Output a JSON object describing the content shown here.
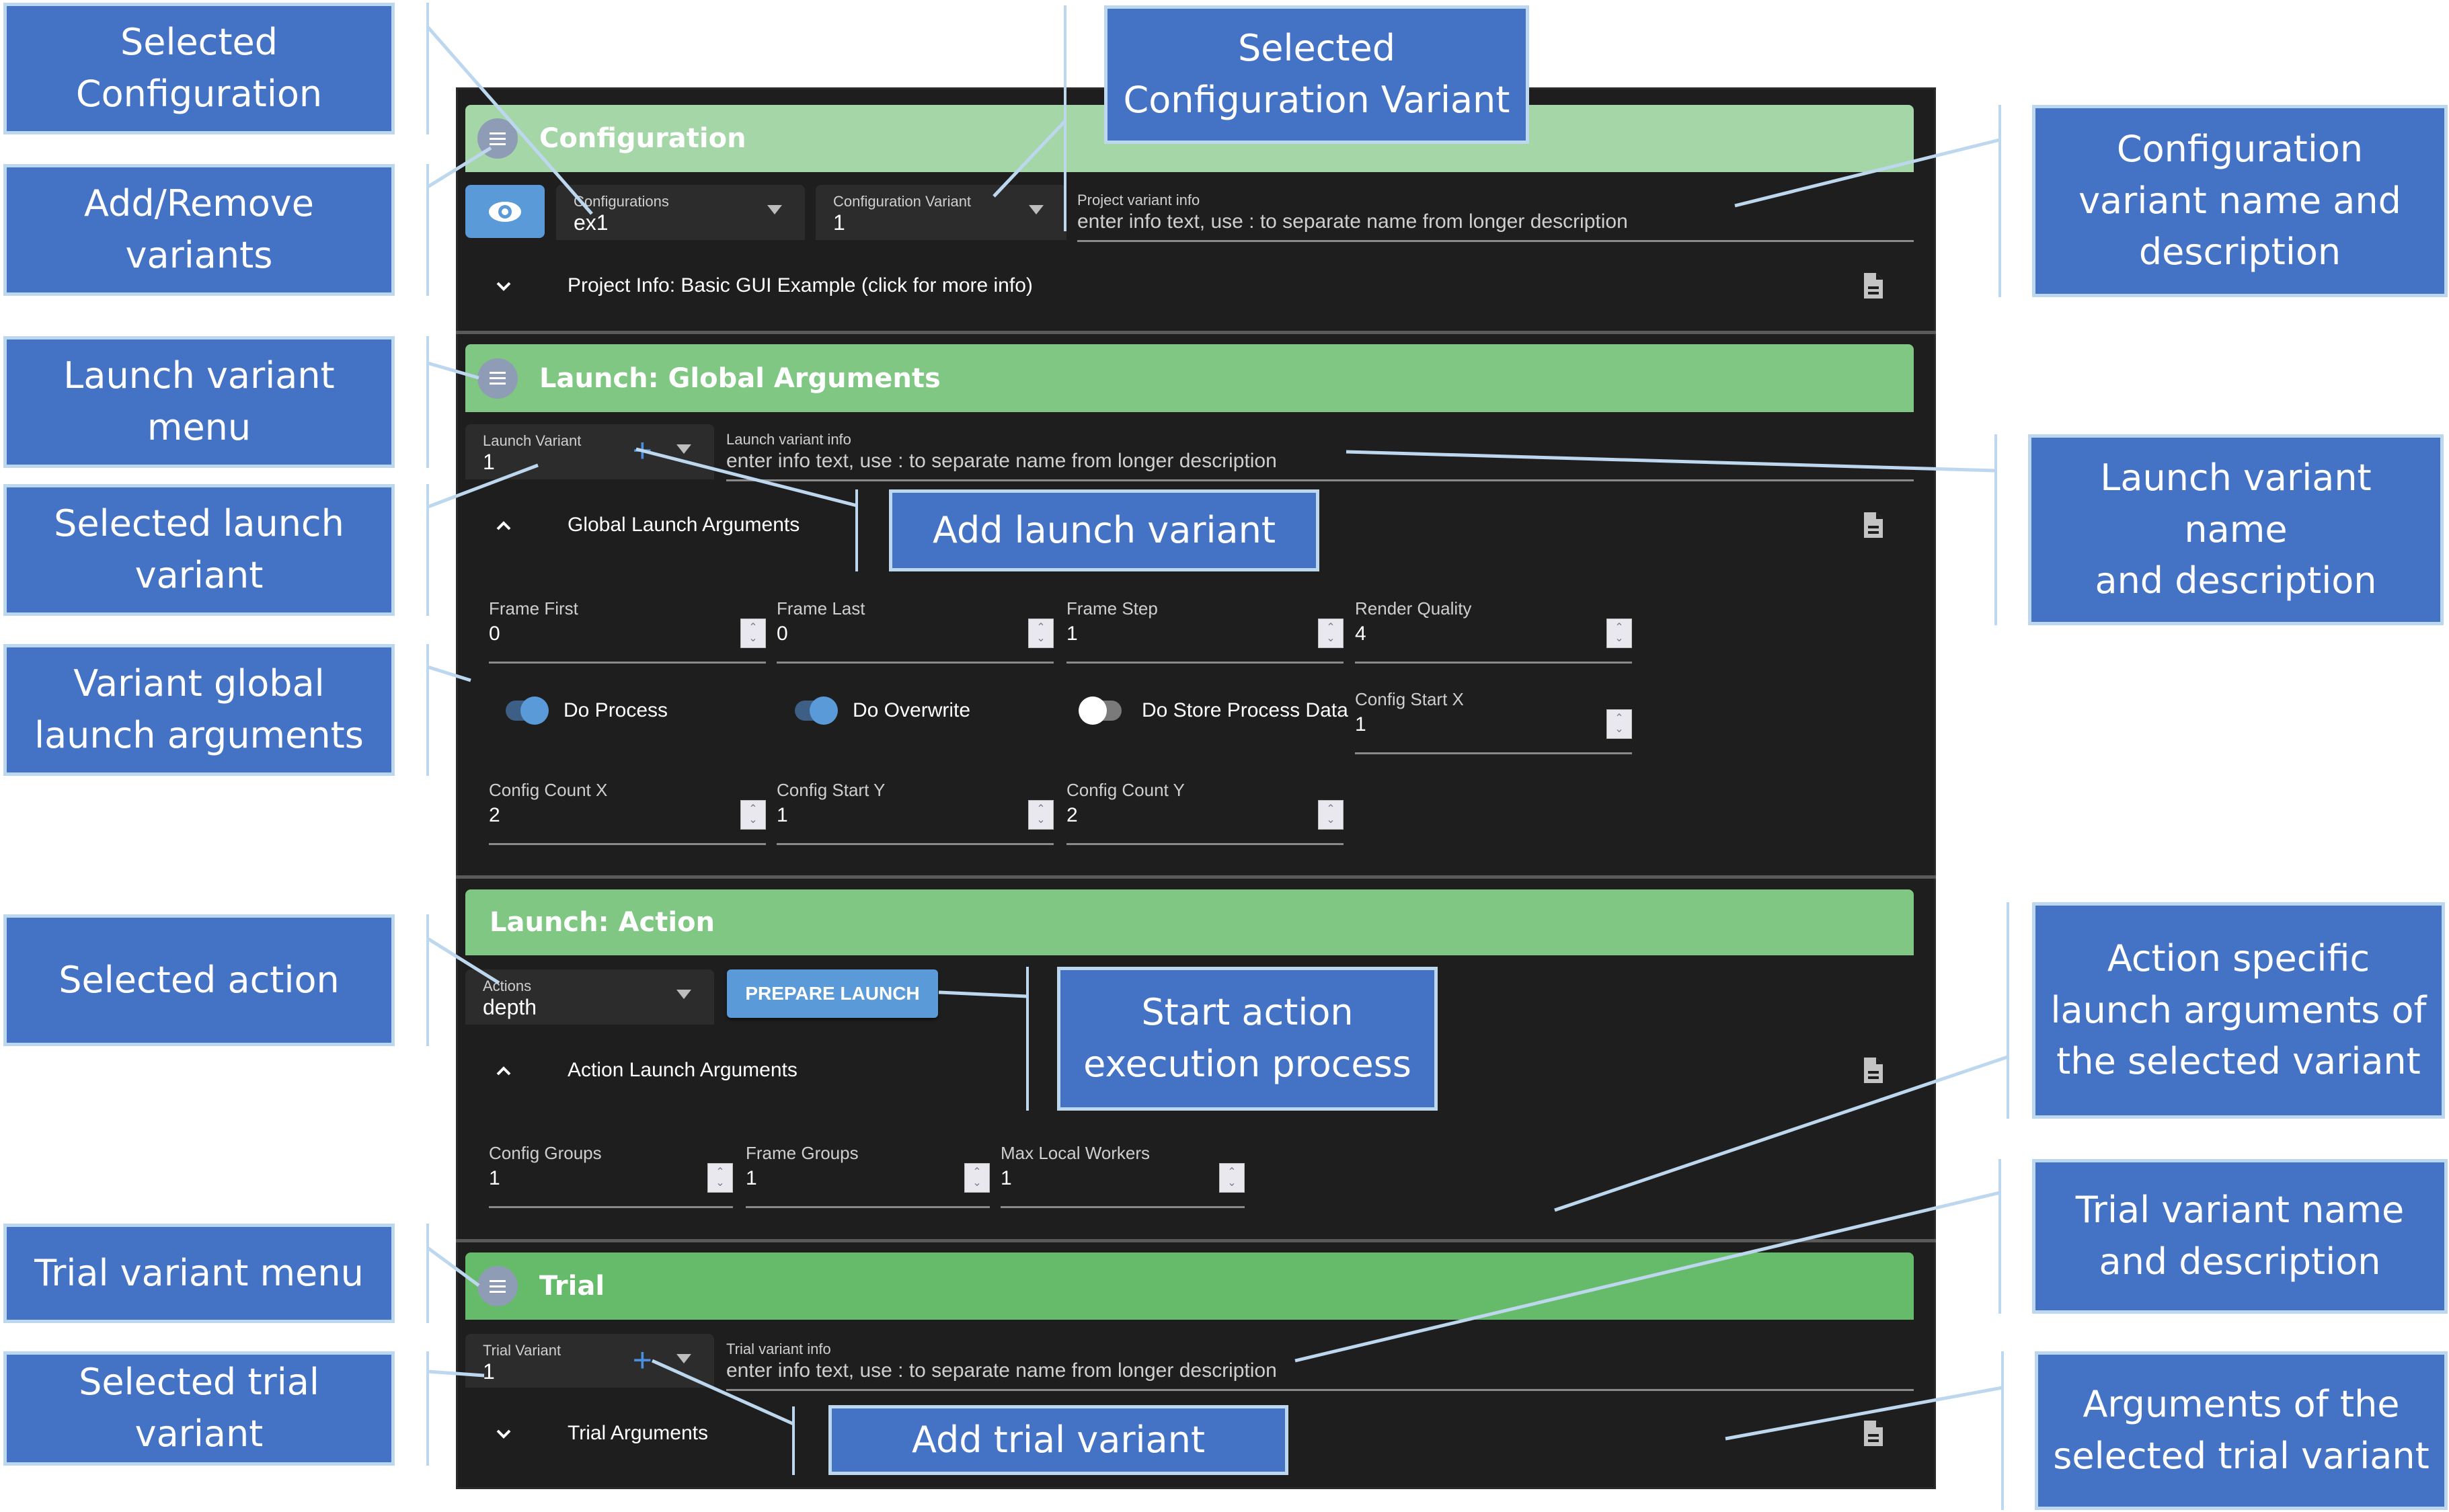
{
  "app": {
    "configuration": {
      "title": "Configuration",
      "header_color": "#a5d6a7",
      "configurations_label": "Configurations",
      "configurations_value": "ex1",
      "config_variant_label": "Configuration Variant",
      "config_variant_value": "1",
      "project_info_label": "Project variant info",
      "project_info_placeholder": "enter info text, use : to separate name from longer description",
      "project_info_row": "Project Info: Basic GUI Example (click for more info)"
    },
    "launch_global": {
      "title": "Launch: Global Arguments",
      "header_color": "#81c784",
      "variant_label": "Launch Variant",
      "variant_value": "1",
      "info_label": "Launch variant info",
      "info_placeholder": "enter info text, use : to separate name from longer description",
      "args_row": "Global Launch Arguments",
      "fields": [
        {
          "label": "Frame First",
          "value": "0"
        },
        {
          "label": "Frame Last",
          "value": "0"
        },
        {
          "label": "Frame Step",
          "value": "1"
        },
        {
          "label": "Render Quality",
          "value": "4"
        },
        {
          "label": "Config Start X",
          "value": "1"
        },
        {
          "label": "Config Count X",
          "value": "2"
        },
        {
          "label": "Config Start Y",
          "value": "1"
        },
        {
          "label": "Config Count Y",
          "value": "2"
        }
      ],
      "toggles": [
        {
          "label": "Do Process",
          "on": true
        },
        {
          "label": "Do Overwrite",
          "on": true
        },
        {
          "label": "Do Store Process Data",
          "on": false
        }
      ]
    },
    "launch_action": {
      "title": "Launch: Action",
      "header_color": "#81c784",
      "actions_label": "Actions",
      "actions_value": "depth",
      "prepare_button": "PREPARE LAUNCH",
      "args_row": "Action Launch Arguments",
      "fields": [
        {
          "label": "Config Groups",
          "value": "1"
        },
        {
          "label": "Frame Groups",
          "value": "1"
        },
        {
          "label": "Max Local Workers",
          "value": "1"
        }
      ]
    },
    "trial": {
      "title": "Trial",
      "header_color": "#66bb6a",
      "variant_label": "Trial Variant",
      "variant_value": "1",
      "info_label": "Trial variant info",
      "info_placeholder": "enter info text, use : to separate name from longer description",
      "args_row": "Trial Arguments"
    }
  },
  "callouts": {
    "selected_configuration": "Selected\nConfiguration",
    "add_remove_variants": "Add/Remove\nvariants",
    "launch_variant_menu": "Launch variant\nmenu",
    "selected_launch_variant": "Selected launch\nvariant",
    "variant_global_args": "Variant global\nlaunch arguments",
    "selected_action": "Selected action",
    "trial_variant_menu": "Trial variant menu",
    "selected_trial_variant": "Selected trial\nvariant",
    "selected_config_variant": "Selected\nConfiguration Variant",
    "add_launch_variant": "Add launch variant",
    "start_action": "Start action\nexecution process",
    "add_trial_variant": "Add trial variant",
    "config_variant_name_desc": "Configuration\nvariant name and\ndescription",
    "launch_variant_name_desc": "Launch variant name\nand description",
    "action_specific_args": "Action specific\nlaunch arguments of\nthe selected variant",
    "trial_variant_name_desc": "Trial variant name\nand description",
    "trial_args": "Arguments of the\nselected trial variant"
  }
}
